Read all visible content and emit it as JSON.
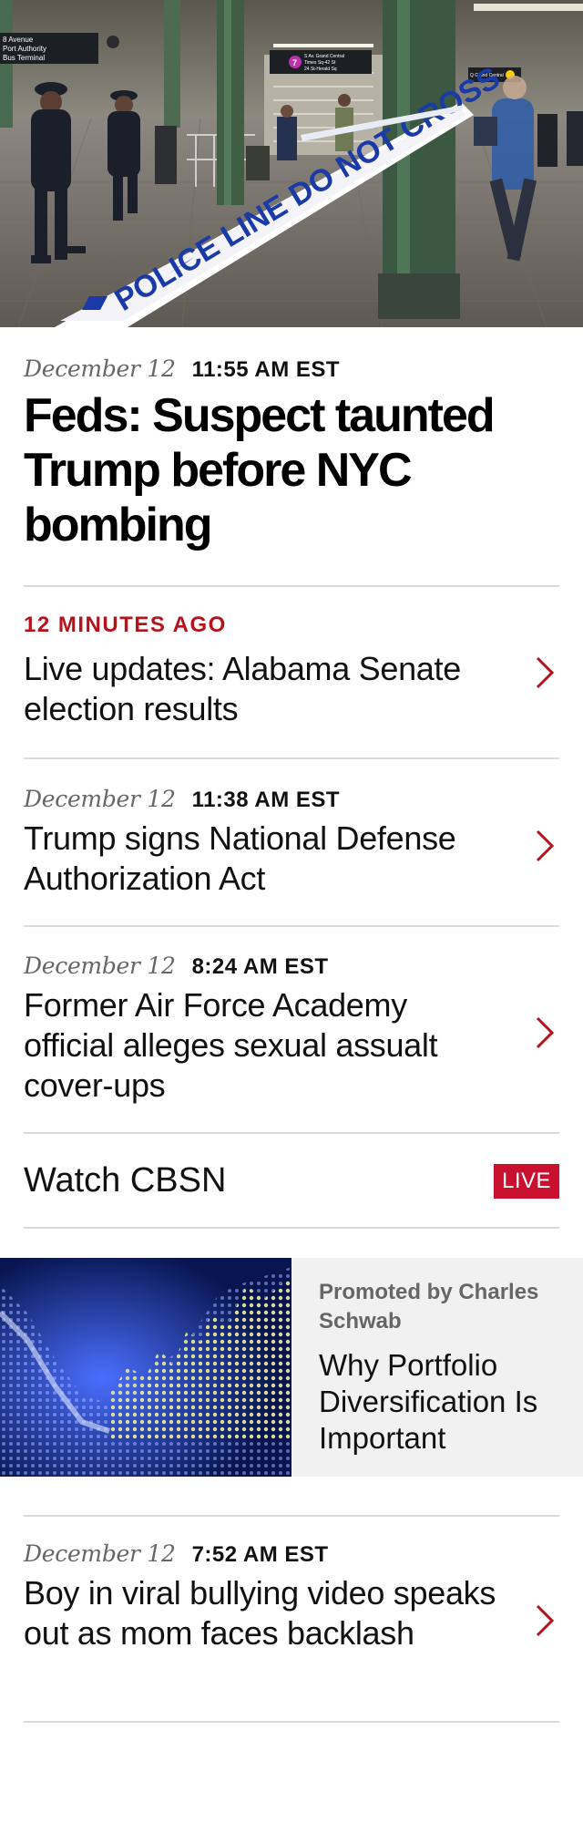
{
  "hero": {
    "photo_description": "Subway station with police officers and crime scene tape",
    "signs": {
      "left_top": "8 Avenue",
      "left_mid": "Port Authority",
      "left_bot": "Bus Terminal",
      "center_top": "S Av. Grand Central",
      "center_mid": "Times Sq-42 St",
      "center_bot": "24 St-Herald Sq",
      "route": "7",
      "right": "Q Grand Central"
    },
    "tape_text": "POLICE LINE DO NOT CROSS"
  },
  "lead": {
    "date": "December 12",
    "time": "11:55 AM EST",
    "headline": "Feds: Suspect taunted Trump before NYC bombing"
  },
  "stories": [
    {
      "ago": "12 MINUTES AGO",
      "title": "Live updates: Alabama Senate election results"
    },
    {
      "date": "December 12",
      "time": "11:38 AM EST",
      "title": "Trump signs National Defense Authorization Act"
    },
    {
      "date": "December 12",
      "time": "8:24 AM EST",
      "title": "Former Air Force Academy official alleges sexual assualt cover-ups"
    }
  ],
  "watch": {
    "label": "Watch CBSN",
    "badge": "LIVE"
  },
  "promo": {
    "by": "Promoted by Charles Schwab",
    "title": "Why Portfolio Diversification Is Important"
  },
  "last_story": {
    "date": "December 12",
    "time": "7:52 AM EST",
    "title": "Boy in viral bullying video speaks out as mom faces backlash"
  },
  "colors": {
    "accent_red": "#b5121b",
    "live_red": "#c9102f",
    "divider": "#dadada"
  },
  "icons": {
    "chevron": "chevron-right-icon"
  }
}
